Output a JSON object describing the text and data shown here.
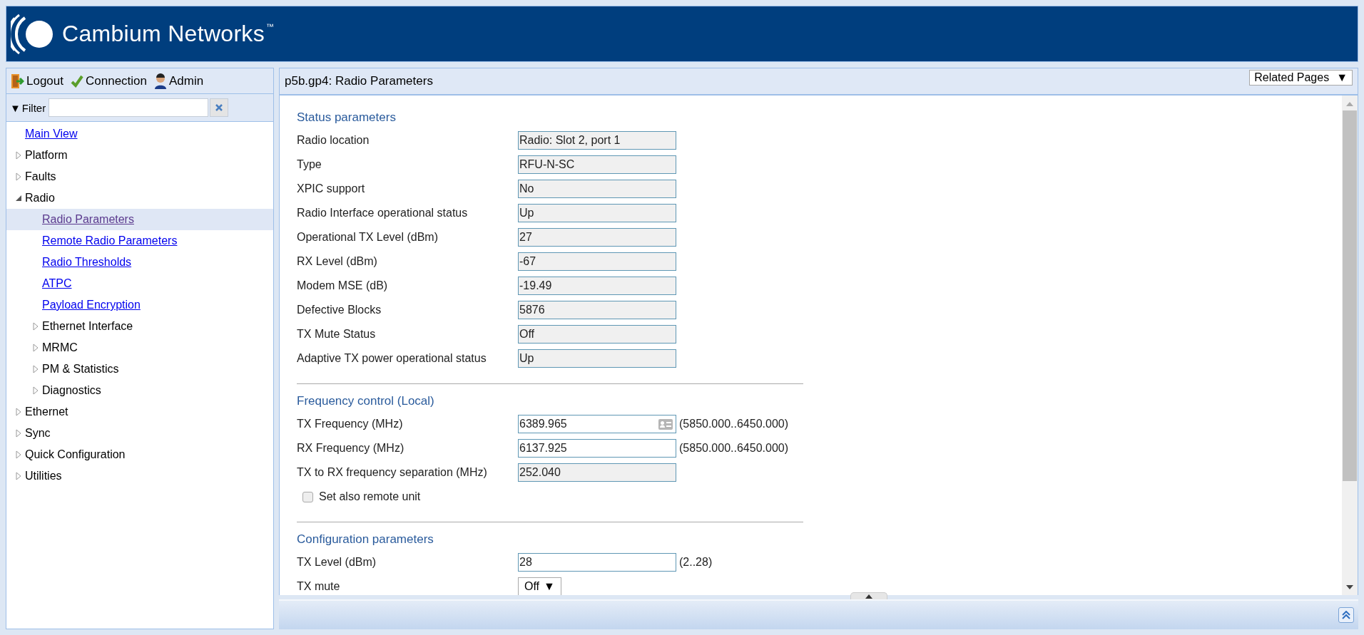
{
  "header": {
    "brand": "Cambium Networks",
    "trademark": "™"
  },
  "sidebar": {
    "toolbar": [
      {
        "kind": "logout",
        "label": "Logout"
      },
      {
        "kind": "connection",
        "label": "Connection"
      },
      {
        "kind": "admin",
        "label": "Admin"
      }
    ],
    "filter": {
      "toggle": "▼",
      "label": "Filter"
    },
    "tree": [
      {
        "kind": "link",
        "label": "Main View",
        "selected": false
      },
      {
        "kind": "folder",
        "label": "Platform",
        "expanded": false
      },
      {
        "kind": "folder",
        "label": "Faults",
        "expanded": false
      },
      {
        "kind": "folder",
        "label": "Radio",
        "expanded": true,
        "children": [
          {
            "kind": "link",
            "label": "Radio Parameters",
            "selected": true
          },
          {
            "kind": "link",
            "label": "Remote Radio Parameters",
            "selected": false
          },
          {
            "kind": "link",
            "label": "Radio Thresholds",
            "selected": false
          },
          {
            "kind": "link",
            "label": "ATPC",
            "selected": false
          },
          {
            "kind": "link",
            "label": "Payload Encryption",
            "selected": false
          },
          {
            "kind": "folder",
            "label": "Ethernet Interface",
            "expanded": false
          },
          {
            "kind": "folder",
            "label": "MRMC",
            "expanded": false
          },
          {
            "kind": "folder",
            "label": "PM & Statistics",
            "expanded": false
          },
          {
            "kind": "folder",
            "label": "Diagnostics",
            "expanded": false
          }
        ]
      },
      {
        "kind": "folder",
        "label": "Ethernet",
        "expanded": false
      },
      {
        "kind": "folder",
        "label": "Sync",
        "expanded": false
      },
      {
        "kind": "folder",
        "label": "Quick Configuration",
        "expanded": false
      },
      {
        "kind": "folder",
        "label": "Utilities",
        "expanded": false
      }
    ]
  },
  "main": {
    "title": "p5b.gp4: Radio Parameters",
    "related_pages": {
      "label": "Related Pages",
      "caret": "▼"
    },
    "sections": [
      {
        "title": "Status parameters",
        "rows": [
          {
            "kind": "readonly",
            "label": "Radio location",
            "value": "Radio: Slot 2, port 1"
          },
          {
            "kind": "readonly",
            "label": "Type",
            "value": "RFU-N-SC"
          },
          {
            "kind": "readonly",
            "label": "XPIC support",
            "value": "No"
          },
          {
            "kind": "readonly",
            "label": "Radio Interface operational status",
            "value": "Up"
          },
          {
            "kind": "readonly",
            "label": "Operational TX Level (dBm)",
            "value": "27"
          },
          {
            "kind": "readonly",
            "label": "RX Level (dBm)",
            "value": "-67"
          },
          {
            "kind": "readonly",
            "label": "Modem MSE (dB)",
            "value": "-19.49"
          },
          {
            "kind": "readonly",
            "label": "Defective Blocks",
            "value": "5876"
          },
          {
            "kind": "readonly",
            "label": "TX Mute Status",
            "value": "Off"
          },
          {
            "kind": "readonly",
            "label": "Adaptive TX power operational status",
            "value": "Up"
          }
        ]
      },
      {
        "title": "Frequency control (Local)",
        "rows": [
          {
            "kind": "input",
            "label": "TX Frequency (MHz)",
            "value": "6389.965",
            "picker": true,
            "range": "(5850.000..6450.000)"
          },
          {
            "kind": "input",
            "label": "RX Frequency (MHz)",
            "value": "6137.925",
            "picker": false,
            "range": "(5850.000..6450.000)"
          },
          {
            "kind": "readonly",
            "label": "TX to RX frequency separation (MHz)",
            "value": "252.040"
          },
          {
            "kind": "checkbox",
            "label": "Set also remote unit",
            "checked": false
          }
        ]
      },
      {
        "title": "Configuration parameters",
        "rows": [
          {
            "kind": "input",
            "label": "TX Level (dBm)",
            "value": "28",
            "picker": false,
            "range": "(2..28)"
          },
          {
            "kind": "select",
            "label": "TX mute",
            "value": "Off",
            "caret": "▼"
          }
        ]
      }
    ]
  }
}
